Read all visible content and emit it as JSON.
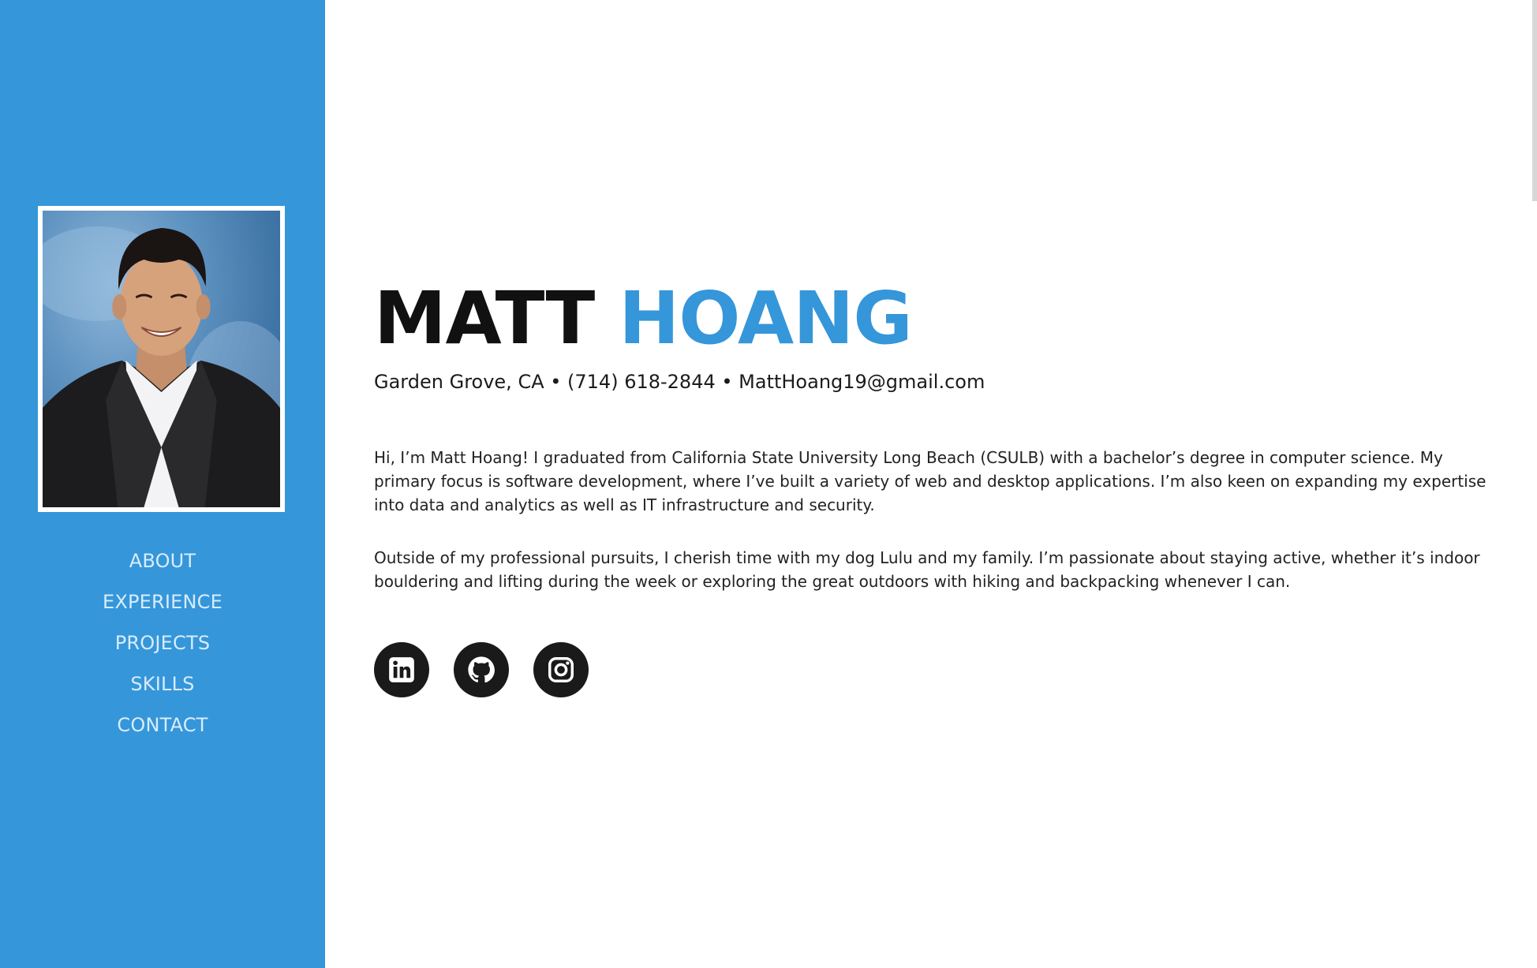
{
  "profile": {
    "first_name": "MATT",
    "last_name": "HOANG",
    "contact_line": "Garden Grove, CA • (714) 618-2844 • MattHoang19@gmail.com",
    "photo_alt": "Matt Hoang headshot"
  },
  "nav": {
    "items": [
      {
        "label": "ABOUT"
      },
      {
        "label": "EXPERIENCE"
      },
      {
        "label": "PROJECTS"
      },
      {
        "label": "SKILLS"
      },
      {
        "label": "CONTACT"
      }
    ]
  },
  "bio": {
    "paragraph_1": "Hi, I’m Matt Hoang! I graduated from California State University Long Beach (CSULB) with a bachelor’s degree in computer science. My primary focus is software development, where I’ve built a variety of web and desktop applications. I’m also keen on expanding my expertise into data and analytics as well as IT infrastructure and security.",
    "paragraph_2": "Outside of my professional pursuits, I cherish time with my dog Lulu and my family. I’m passionate about staying active, whether it’s indoor bouldering and lifting during the week or exploring the great outdoors with hiking and backpacking whenever I can."
  },
  "socials": [
    {
      "icon": "linkedin-icon"
    },
    {
      "icon": "github-icon"
    },
    {
      "icon": "instagram-icon"
    }
  ],
  "colors": {
    "accent": "#3596da",
    "sidebar_bg": "#3596da",
    "nav_text": "#d8ecfb",
    "heading_dark": "#111111",
    "social_bg": "#1a1a1a"
  }
}
